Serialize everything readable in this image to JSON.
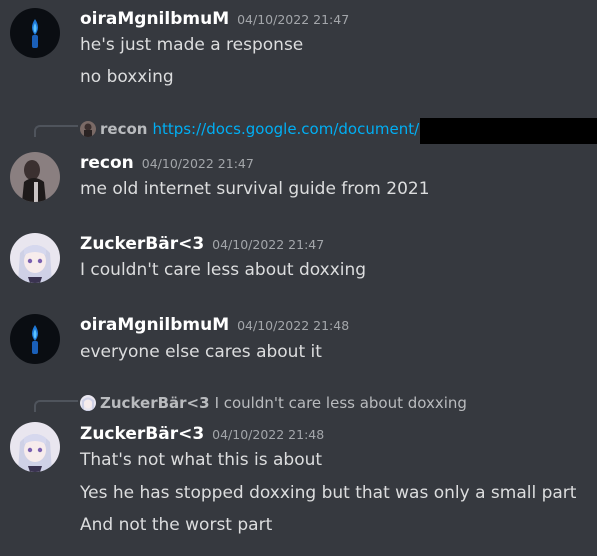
{
  "messages": [
    {
      "author": "oiraMgnilbmuM",
      "timestamp": "04/10/2022 21:47",
      "lines": [
        "he's just made a response",
        "no boxxing"
      ]
    },
    {
      "reply": {
        "author": "recon",
        "text": "https://docs.google.com/document/"
      },
      "author": "recon",
      "timestamp": "04/10/2022 21:47",
      "lines": [
        "me old internet survival guide from 2021"
      ]
    },
    {
      "author": "ZuckerBär<3",
      "timestamp": "04/10/2022 21:47",
      "lines": [
        "I couldn't care less about doxxing"
      ]
    },
    {
      "author": "oiraMgnilbmuM",
      "timestamp": "04/10/2022 21:48",
      "lines": [
        "everyone else cares about it"
      ]
    },
    {
      "reply": {
        "author": "ZuckerBär<3",
        "text": "I couldn't care less about doxxing"
      },
      "author": "ZuckerBär<3",
      "timestamp": "04/10/2022 21:48",
      "lines": [
        "That's not what this is about",
        "Yes he has stopped doxxing but that was only a small part",
        "And not the worst part"
      ]
    }
  ],
  "colors": {
    "background": "#36393f",
    "username": "#ffffff",
    "message_text": "#dcddde",
    "timestamp": "#a3a6aa",
    "link": "#00aff4"
  }
}
